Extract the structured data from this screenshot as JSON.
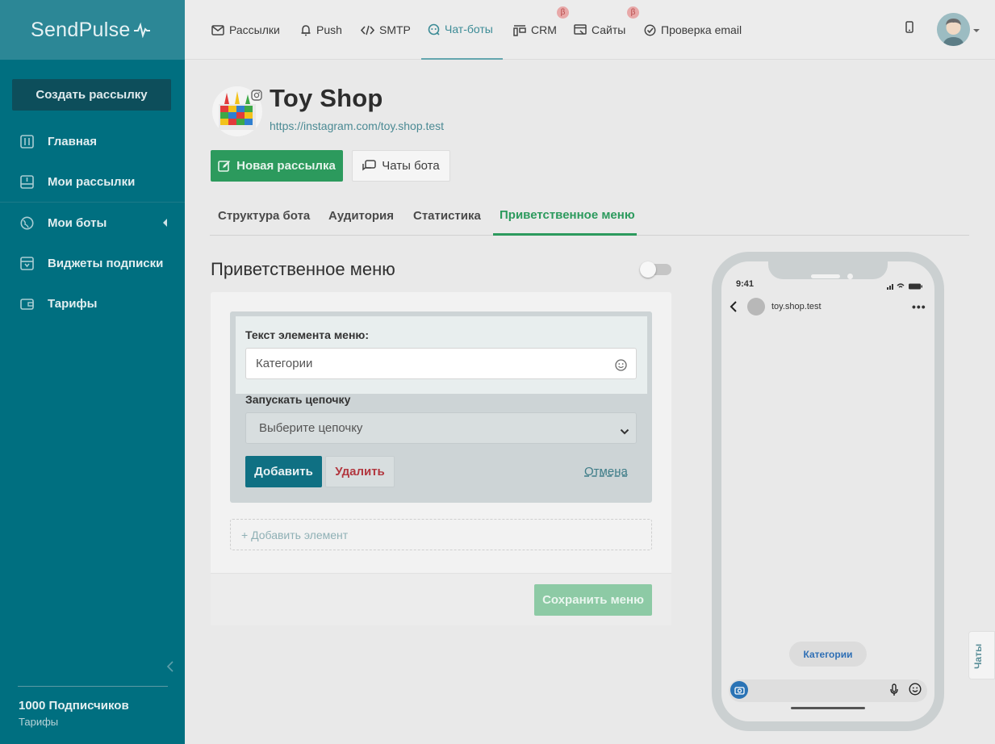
{
  "brand": {
    "logo_text": "SendPulse"
  },
  "sidebar": {
    "create_button": "Создать рассылку",
    "items": [
      {
        "label": "Главная",
        "icon": "home-icon"
      },
      {
        "label": "Мои рассылки",
        "icon": "mail-tray-icon"
      },
      {
        "label": "Мои боты",
        "icon": "globe-icon"
      },
      {
        "label": "Виджеты подписки",
        "icon": "widget-icon"
      },
      {
        "label": "Тарифы",
        "icon": "wallet-icon"
      }
    ],
    "subscribers": "1000 Подписчиков",
    "tariffs_link": "Тарифы"
  },
  "topnav": {
    "items": [
      {
        "label": "Рассылки",
        "icon": "envelope-icon"
      },
      {
        "label": "Push",
        "icon": "bell-icon"
      },
      {
        "label": "SMTP",
        "icon": "code-icon"
      },
      {
        "label": "Чат-боты",
        "icon": "chatbot-icon",
        "active": true
      },
      {
        "label": "CRM",
        "icon": "crm-icon",
        "beta": "β"
      },
      {
        "label": "Сайты",
        "icon": "site-icon",
        "beta": "β"
      },
      {
        "label": "Проверка email",
        "icon": "check-circle-icon"
      }
    ]
  },
  "bot": {
    "name": "Toy Shop",
    "url": "https://instagram.com/toy.shop.test"
  },
  "actions": {
    "new_mailing": "Новая рассылка",
    "bot_chats": "Чаты бота"
  },
  "tabs": [
    {
      "label": "Структура бота"
    },
    {
      "label": "Аудитория"
    },
    {
      "label": "Статистика"
    },
    {
      "label": "Приветственное меню",
      "active": true
    }
  ],
  "menu_editor": {
    "title": "Приветственное меню",
    "toggle_on": false,
    "item_text_label": "Текст элемента меню:",
    "item_text_value": "Категории",
    "chain_label": "Запускать цепочку",
    "chain_placeholder": "Выберите цепочку",
    "add_button": "Добавить",
    "delete_button": "Удалить",
    "cancel_link": "Отмена",
    "add_element": "+ Добавить элемент",
    "save_button": "Сохранить меню"
  },
  "phone_preview": {
    "time": "9:41",
    "username": "toy.shop.test",
    "chip": "Категории"
  },
  "chats_side_tab": "Чаты",
  "colors": {
    "sidebar": "#006f80",
    "accent_green": "#2c9a5d",
    "accent_teal": "#0f7083",
    "danger": "#b2373f"
  }
}
